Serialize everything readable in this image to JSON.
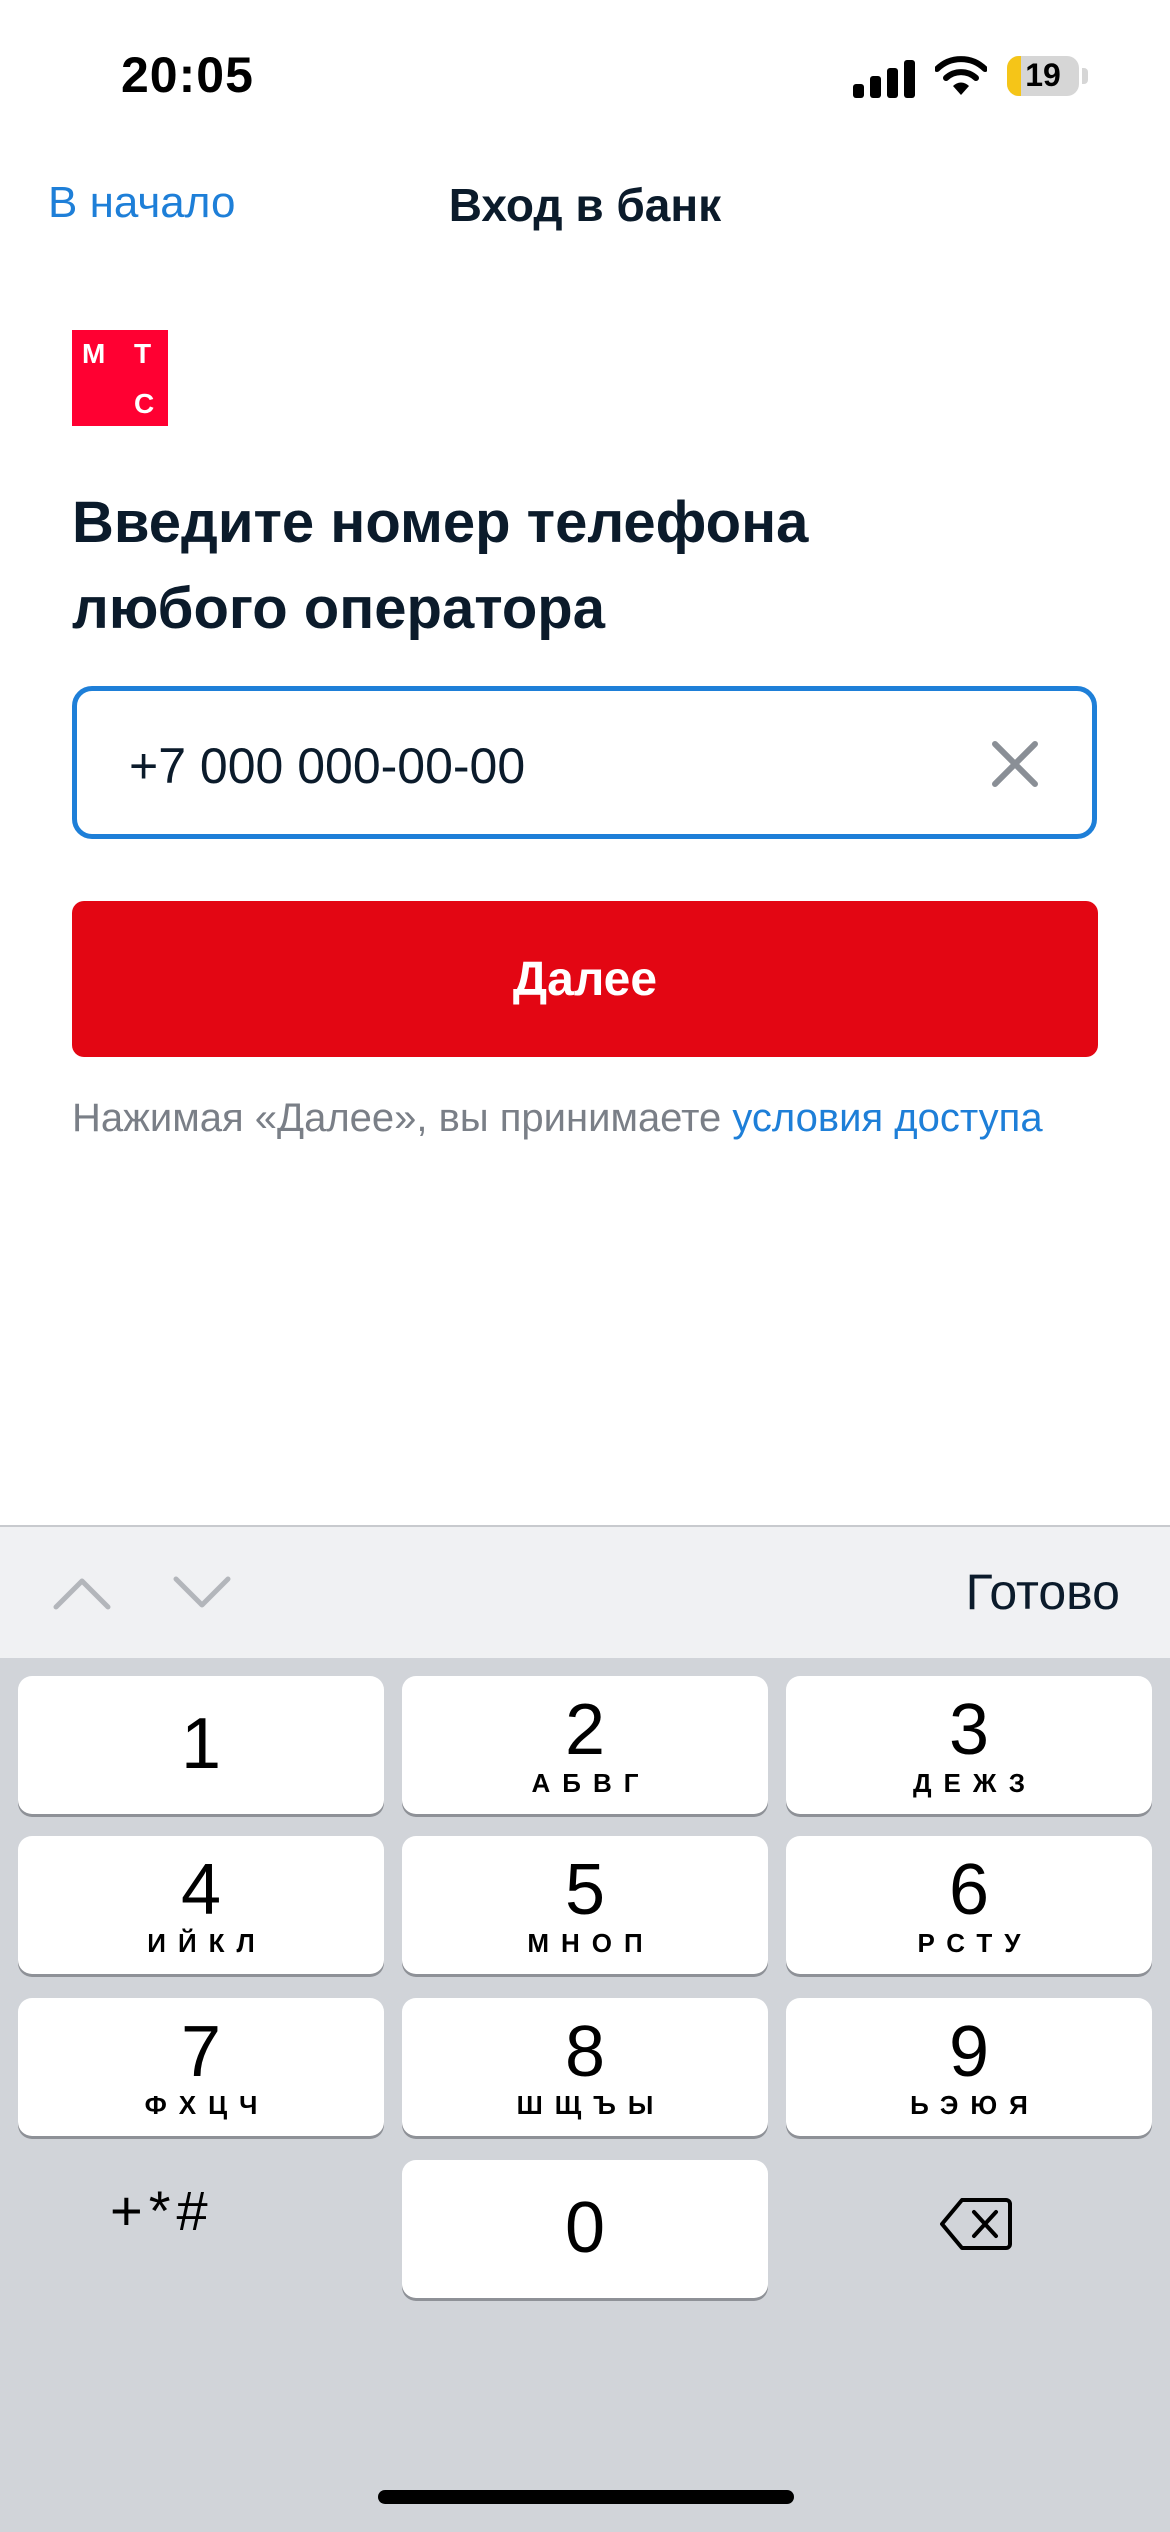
{
  "status_bar": {
    "time": "20:05",
    "battery_level": "19",
    "icons": [
      "signal-icon",
      "wifi-icon",
      "battery-icon"
    ]
  },
  "nav": {
    "back_label": "В начало",
    "title": "Вход в банк"
  },
  "logo": {
    "letters": [
      "М",
      "Т",
      "С"
    ],
    "color": "#ff0032"
  },
  "heading": {
    "line1": "Введите номер телефона",
    "line2": "любого оператора"
  },
  "phone_input": {
    "value": "+7 000 000-00-00",
    "clear_icon": "close-icon"
  },
  "next_button": {
    "label": "Далее",
    "color": "#e30613"
  },
  "terms": {
    "prefix": "Нажимая «Далее», вы принимаете ",
    "link": "условия доступа"
  },
  "keyboard_toolbar": {
    "done_label": "Готово",
    "icons": [
      "chevron-up-icon",
      "chevron-down-icon"
    ]
  },
  "keyboard": {
    "keys": [
      {
        "digit": "1",
        "letters": ""
      },
      {
        "digit": "2",
        "letters": "АБВГ"
      },
      {
        "digit": "3",
        "letters": "ДЕЖЗ"
      },
      {
        "digit": "4",
        "letters": "ИЙКЛ"
      },
      {
        "digit": "5",
        "letters": "МНОП"
      },
      {
        "digit": "6",
        "letters": "РСТУ"
      },
      {
        "digit": "7",
        "letters": "ФХЦЧ"
      },
      {
        "digit": "8",
        "letters": "ШЩЪЫ"
      },
      {
        "digit": "9",
        "letters": "ЬЭЮЯ"
      },
      {
        "digit": "0",
        "letters": ""
      }
    ],
    "symbols": "+*#",
    "backspace_icon": "backspace-icon"
  },
  "accent_colors": {
    "link_blue": "#1e7fd8",
    "text_dark": "#0b1b2b"
  }
}
